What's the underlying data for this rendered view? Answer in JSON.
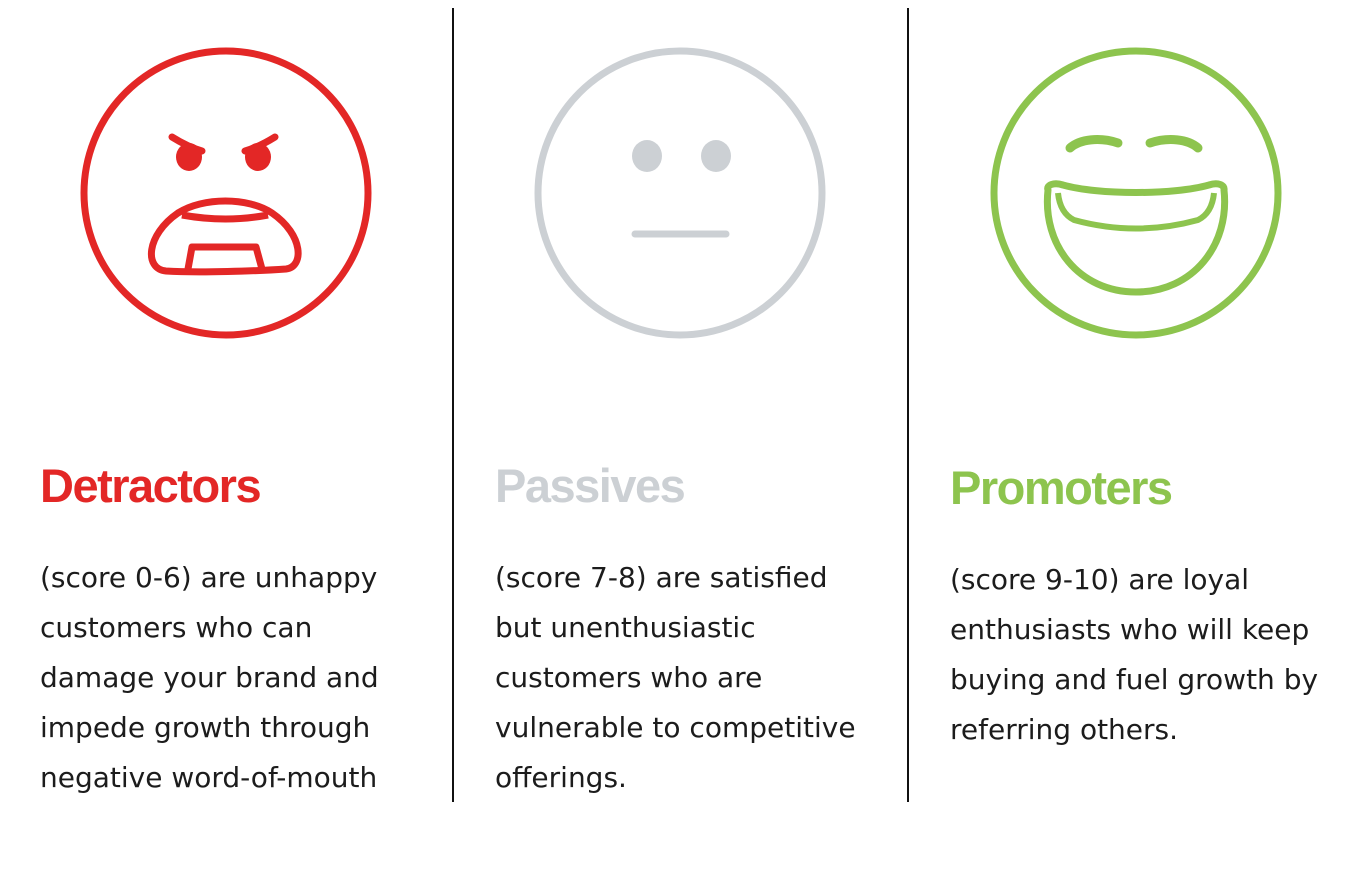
{
  "colors": {
    "detractors": "#e32726",
    "passives": "#ccd0d4",
    "promoters": "#8dc44e",
    "divider": "#111111",
    "text": "#1c1c1c"
  },
  "columns": [
    {
      "icon": "angry-face-icon",
      "heading": "Detractors",
      "lines": [
        "(score 0-6) are unhappy",
        "customers who can",
        "damage your brand and",
        "impede growth through",
        "negative word-of-mouth"
      ]
    },
    {
      "icon": "neutral-face-icon",
      "heading": "Passives",
      "lines": [
        "(score 7-8) are satisfied",
        "but unenthusiastic",
        "customers who are",
        "vulnerable to competitive",
        "offerings."
      ]
    },
    {
      "icon": "laughing-face-icon",
      "heading": "Promoters",
      "lines": [
        "(score 9-10) are loyal",
        "enthusiasts who will keep",
        "buying and fuel growth by",
        "referring others."
      ]
    }
  ]
}
